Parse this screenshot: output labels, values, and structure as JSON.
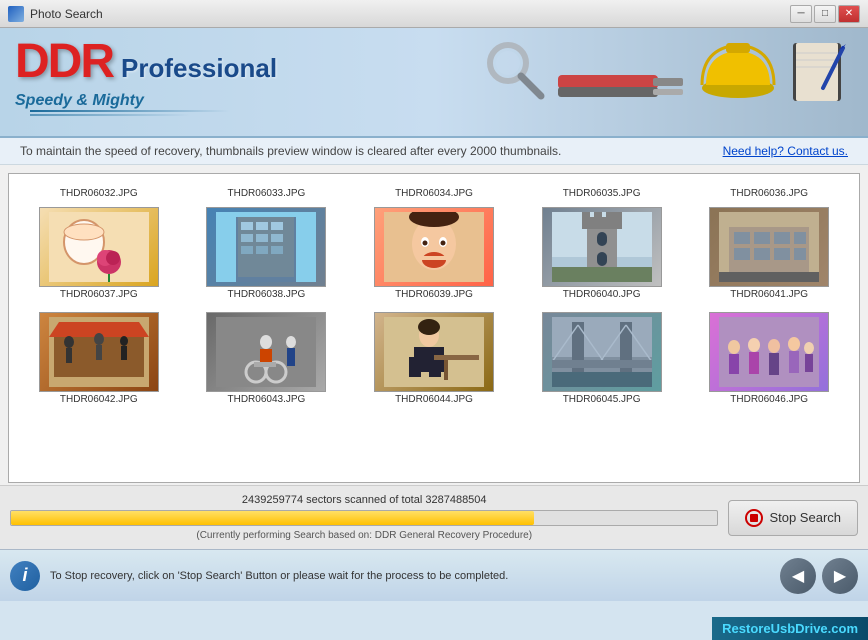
{
  "window": {
    "title": "Photo Search",
    "controls": {
      "minimize": "─",
      "maximize": "□",
      "close": "✕"
    }
  },
  "header": {
    "brand_ddr": "DDR",
    "brand_professional": "Professional",
    "tagline": "Speedy & Mighty"
  },
  "info_bar": {
    "message": "To maintain the speed of recovery, thumbnails preview window is cleared after every 2000 thumbnails.",
    "link": "Need help? Contact us."
  },
  "thumbnails": {
    "row1": [
      {
        "label": "THDR06032.JPG",
        "style": "img-cup"
      },
      {
        "label": "THDR06033.JPG",
        "style": "img-building"
      },
      {
        "label": "THDR06034.JPG",
        "style": "img-child"
      },
      {
        "label": "THDR06035.JPG",
        "style": "img-castle"
      },
      {
        "label": "THDR06036.JPG",
        "style": "img-house"
      }
    ],
    "row2": [
      {
        "label": "THDR06037.JPG",
        "style": "img-cup"
      },
      {
        "label": "THDR06038.JPG",
        "style": "img-building"
      },
      {
        "label": "THDR06039.JPG",
        "style": "img-child"
      },
      {
        "label": "THDR06040.JPG",
        "style": "img-castle"
      },
      {
        "label": "THDR06041.JPG",
        "style": "img-house"
      }
    ],
    "row3": [
      {
        "label": "THDR06042.JPG",
        "style": "img-market"
      },
      {
        "label": "THDR06043.JPG",
        "style": "img-street"
      },
      {
        "label": "THDR06044.JPG",
        "style": "img-woman"
      },
      {
        "label": "THDR06045.JPG",
        "style": "img-bridge"
      },
      {
        "label": "THDR06046.JPG",
        "style": "img-crowd"
      }
    ]
  },
  "progress": {
    "text": "2439259774 sectors scanned of total 3287488504",
    "fill_percent": 74,
    "subtext": "(Currently performing Search based on:  DDR General Recovery Procedure)",
    "stop_button": "Stop Search"
  },
  "status_bar": {
    "message": "To Stop recovery, click on 'Stop Search' Button or please wait for the process to be completed."
  },
  "watermark": "RestoreUsbDrive.com",
  "nav": {
    "back": "◀",
    "forward": "▶"
  }
}
